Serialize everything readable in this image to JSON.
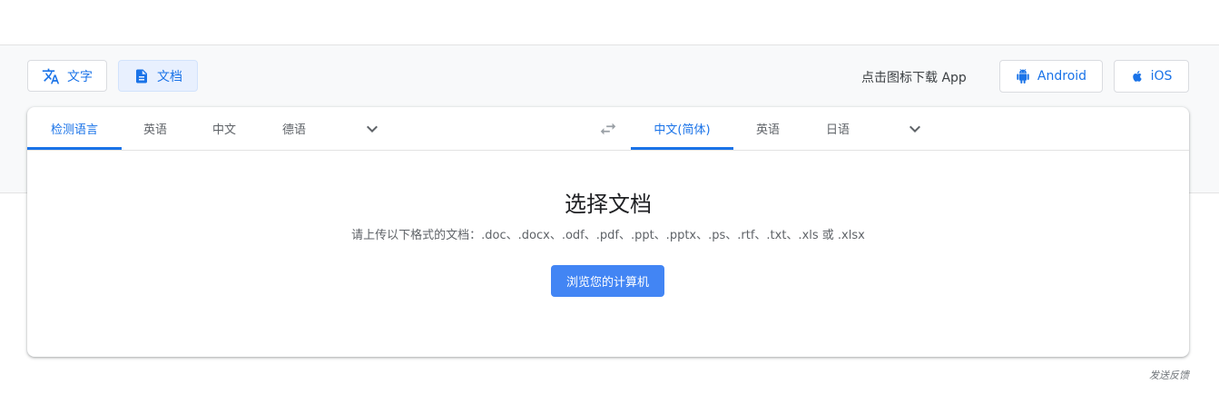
{
  "modes": {
    "text_label": "文字",
    "doc_label": "文档",
    "active": "doc"
  },
  "apps": {
    "download_label": "点击图标下载 App",
    "android_label": "Android",
    "ios_label": "iOS"
  },
  "source_languages": {
    "tabs": [
      "检测语言",
      "英语",
      "中文",
      "德语"
    ],
    "active_index": 0
  },
  "target_languages": {
    "tabs": [
      "中文(简体)",
      "英语",
      "日语"
    ],
    "active_index": 0
  },
  "content": {
    "title": "选择文档",
    "subtitle": "请上传以下格式的文档：.doc、.docx、.odf、.pdf、.ppt、.pptx、.ps、.rtf、.txt、.xls 或 .xlsx",
    "browse_label": "浏览您的计算机"
  },
  "feedback_label": "发送反馈",
  "colors": {
    "accent": "#1a73e8",
    "primary_button": "#4285f4",
    "band_background": "#f8f9fa"
  },
  "icons": {
    "text_mode": "translate-icon",
    "doc_mode": "document-icon",
    "android": "android-icon",
    "ios": "apple-icon",
    "swap": "swap-arrows-icon",
    "more": "chevron-down-icon"
  }
}
